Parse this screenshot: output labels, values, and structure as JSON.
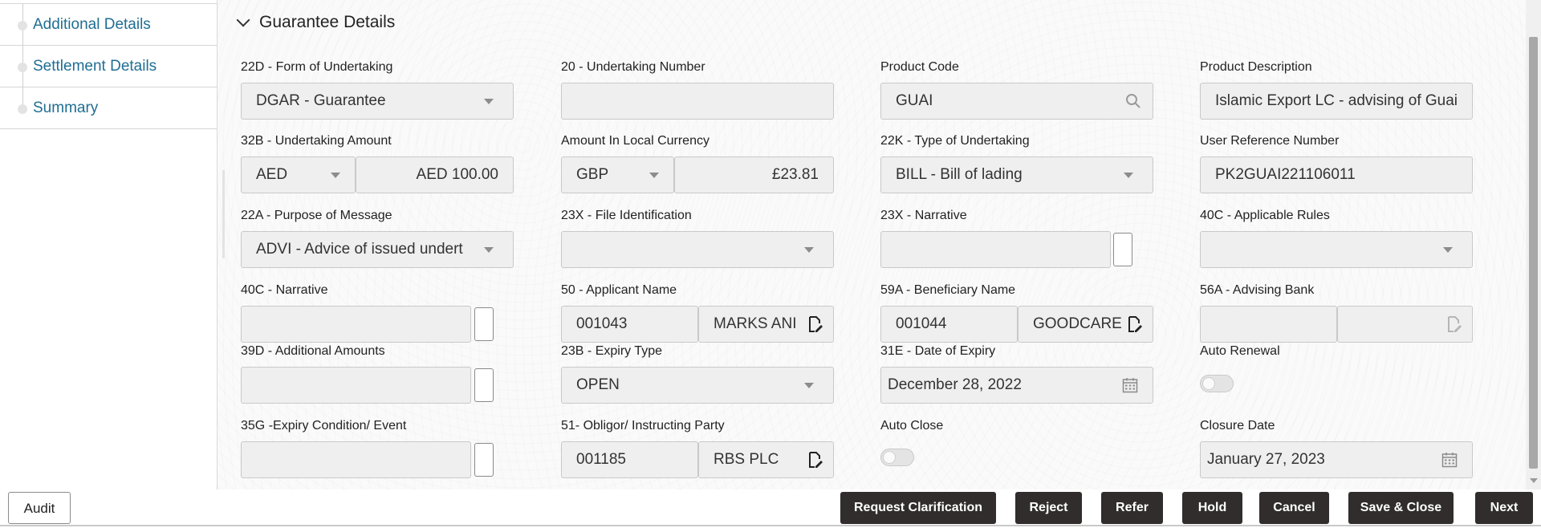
{
  "sidebar": {
    "items": [
      {
        "label": "Additional Details"
      },
      {
        "label": "Settlement Details"
      },
      {
        "label": "Summary"
      }
    ]
  },
  "section": {
    "title": "Guarantee Details"
  },
  "fields": {
    "form_of_undertaking": {
      "label": "22D - Form of Undertaking",
      "value": "DGAR - Guarantee"
    },
    "undertaking_number": {
      "label": "20 - Undertaking Number",
      "value": ""
    },
    "product_code": {
      "label": "Product Code",
      "value": "GUAI"
    },
    "product_description": {
      "label": "Product Description",
      "value": "Islamic Export LC - advising of Guai"
    },
    "undertaking_amount": {
      "label": "32B - Undertaking Amount",
      "currency": "AED",
      "amount": "AED 100.00"
    },
    "amount_local": {
      "label": "Amount In Local Currency",
      "currency": "GBP",
      "amount": "£23.81"
    },
    "type_of_undertaking": {
      "label": "22K - Type of Undertaking",
      "value": "BILL - Bill of lading"
    },
    "user_reference": {
      "label": "User Reference Number",
      "value": "PK2GUAI221106011"
    },
    "purpose_of_message": {
      "label": "22A - Purpose of Message",
      "value": "ADVI - Advice of issued undert"
    },
    "file_identification": {
      "label": "23X - File Identification",
      "value": ""
    },
    "narrative_23x": {
      "label": "23X - Narrative",
      "value": ""
    },
    "applicable_rules": {
      "label": "40C - Applicable Rules",
      "value": ""
    },
    "narrative_40c": {
      "label": "40C - Narrative",
      "value": ""
    },
    "applicant_name": {
      "label": "50 - Applicant Name",
      "id": "001043",
      "name": "MARKS ANI"
    },
    "beneficiary_name": {
      "label": "59A - Beneficiary Name",
      "id": "001044",
      "name": "GOODCARE"
    },
    "advising_bank": {
      "label": "56A - Advising Bank",
      "id": "",
      "name": ""
    },
    "additional_amounts": {
      "label": "39D - Additional Amounts",
      "value": ""
    },
    "expiry_type": {
      "label": "23B - Expiry Type",
      "value": "OPEN"
    },
    "date_of_expiry": {
      "label": "31E - Date of Expiry",
      "value": "December 28, 2022"
    },
    "auto_renewal": {
      "label": "Auto Renewal"
    },
    "expiry_condition": {
      "label": "35G -Expiry Condition/ Event",
      "value": ""
    },
    "obligor": {
      "label": "51- Obligor/ Instructing Party",
      "id": "001185",
      "name": "RBS PLC"
    },
    "auto_close": {
      "label": "Auto Close"
    },
    "closure_date": {
      "label": "Closure Date",
      "value": "January 27, 2023"
    }
  },
  "footer": {
    "audit": "Audit",
    "request_clarification": "Request Clarification",
    "reject": "Reject",
    "refer": "Refer",
    "hold": "Hold",
    "cancel": "Cancel",
    "save_close": "Save & Close",
    "next": "Next"
  },
  "colors": {
    "link": "#1f6e93",
    "button_dark": "#302d2c"
  }
}
